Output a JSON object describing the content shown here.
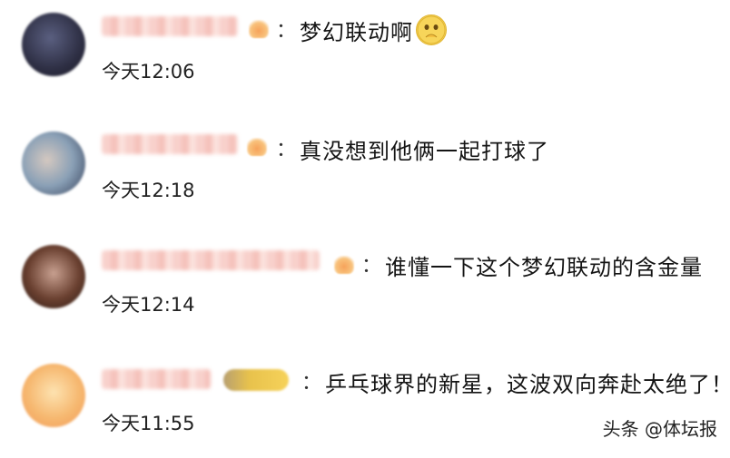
{
  "comments": [
    {
      "username": "",
      "text": "梦幻联动啊",
      "emoji": "pray-emoji",
      "time": "今天12:06"
    },
    {
      "username": "",
      "text": "真没想到他俩一起打球了",
      "time": "今天12:18"
    },
    {
      "username": "",
      "text": "谁懂一下这个梦幻联动的含金量",
      "time": "今天12:14"
    },
    {
      "username": "",
      "text": "乒乓球界的新星，这波双向奔赴太绝了！",
      "time": "今天11:55"
    }
  ],
  "separator": "：",
  "watermark": "头条 @体坛报",
  "colors": {
    "background": "#ffffff",
    "text": "#141414",
    "username_blur": "#f7c9c3",
    "badge": "#f6a25a"
  }
}
